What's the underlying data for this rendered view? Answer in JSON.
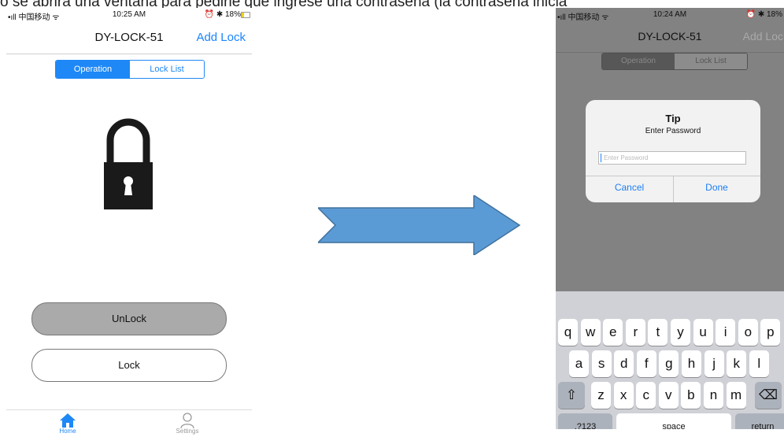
{
  "caption": "o se abrirá una ventana para pedirle que ingrese una contraseña (la contraseña inicia",
  "left_phone": {
    "status": {
      "carrier": "•ıll 中国移动 ᯤ",
      "time": "10:25 AM",
      "battery": "⏰ ✱ 18%"
    },
    "nav": {
      "title": "DY-LOCK-51",
      "action": "Add Lock"
    },
    "segments": [
      "Operation",
      "Lock List"
    ],
    "unlock_label": "UnLock",
    "lock_label": "Lock",
    "tabs": [
      "Home",
      "Settings"
    ],
    "accent": "#1e88f6"
  },
  "right_phone": {
    "status": {
      "carrier": "•ıll 中国移动 ᯤ",
      "time": "10:24 AM",
      "battery": "⏰ ✱ 18%"
    },
    "nav": {
      "title": "DY-LOCK-51",
      "action": "Add Lock"
    },
    "segments": [
      "Operation",
      "Lock List"
    ],
    "dialog": {
      "title": "Tip",
      "message": "Enter Password",
      "placeholder": "Enter Password",
      "cancel": "Cancel",
      "done": "Done"
    },
    "keyboard": {
      "row1": [
        "q",
        "w",
        "e",
        "r",
        "t",
        "y",
        "u",
        "i",
        "o",
        "p"
      ],
      "row2": [
        "a",
        "s",
        "d",
        "f",
        "g",
        "h",
        "j",
        "k",
        "l"
      ],
      "row3": [
        "z",
        "x",
        "c",
        "v",
        "b",
        "n",
        "m"
      ],
      "shift": "⇧",
      "delete": "⌫",
      "numbers": ".?123",
      "space": "space",
      "return": "return"
    }
  },
  "arrow_color": "#5b9bd5"
}
